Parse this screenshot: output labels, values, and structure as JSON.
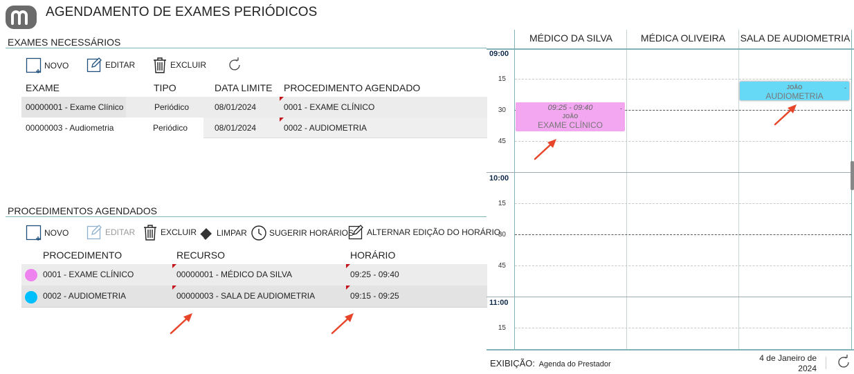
{
  "app": {
    "title": "AGENDAMENTO DE EXAMES PERIÓDICOS",
    "logo_icon": "m-logo-icon"
  },
  "exames": {
    "section_title": "EXAMES NECESSÁRIOS",
    "toolbar": {
      "novo": "NOVO",
      "editar": "EDITAR",
      "excluir": "EXCLUIR",
      "refresh_icon": "refresh-icon"
    },
    "columns": [
      "EXAME",
      "TIPO",
      "DATA LIMITE",
      "PROCEDIMENTO AGENDADO"
    ],
    "rows": [
      {
        "exame": "00000001 - Exame Clínico",
        "tipo": "Periódico",
        "data_limite": "08/01/2024",
        "procedimento": "0001 - EXAME CLÍNICO"
      },
      {
        "exame": "00000003 - Audiometria",
        "tipo": "Periódico",
        "data_limite": "08/01/2024",
        "procedimento": "0002 - AUDIOMETRIA"
      }
    ]
  },
  "procedimentos": {
    "section_title": "PROCEDIMENTOS AGENDADOS",
    "toolbar": {
      "novo": "NOVO",
      "editar": "EDITAR",
      "excluir": "EXCLUIR",
      "limpar": "LIMPAR",
      "sugerir": "SUGERIR HORÁRIOS",
      "alternar": "ALTERNAR EDIÇÃO DO HORÁRIO"
    },
    "columns": [
      "PROCEDIMENTO",
      "RECURSO",
      "HORÁRIO"
    ],
    "rows": [
      {
        "color": "#ee82ee",
        "procedimento": "0001 - EXAME CLÍNICO",
        "recurso": "00000001 - MÉDICO DA SILVA",
        "horario": "09:25 - 09:40"
      },
      {
        "color": "#00bfff",
        "procedimento": "0002 - AUDIOMETRIA",
        "recurso": "00000003 - SALA DE AUDIOMETRIA",
        "horario": "09:15 - 09:25"
      }
    ]
  },
  "calendar": {
    "resources": [
      "MÉDICO DA SILVA",
      "MÉDICA OLIVEIRA",
      "SALA DE AUDIOMETRIA"
    ],
    "hours": [
      "09:00",
      "10:00",
      "11:00"
    ],
    "minute_labels": [
      "15",
      "30",
      "45"
    ],
    "events": [
      {
        "time": "09:25 - 09:40",
        "person": "JOÃO",
        "procedure": "EXAME CLÍNICO",
        "dash": "-",
        "color": "#f2a7f0"
      },
      {
        "person": "JOÃO",
        "procedure": "AUDIOMETRIA",
        "dash": "-",
        "color": "#66d9f7"
      }
    ]
  },
  "footer": {
    "label": "EXIBIÇÃO:",
    "mode": "Agenda do Prestador",
    "date_line1": "4 de Janeiro de",
    "date_line2": "2024",
    "refresh_icon": "refresh-icon"
  },
  "colors": {
    "accent_line": "#7fb3b7",
    "marker_red": "#c4151c",
    "arrow": "#e8462b"
  }
}
